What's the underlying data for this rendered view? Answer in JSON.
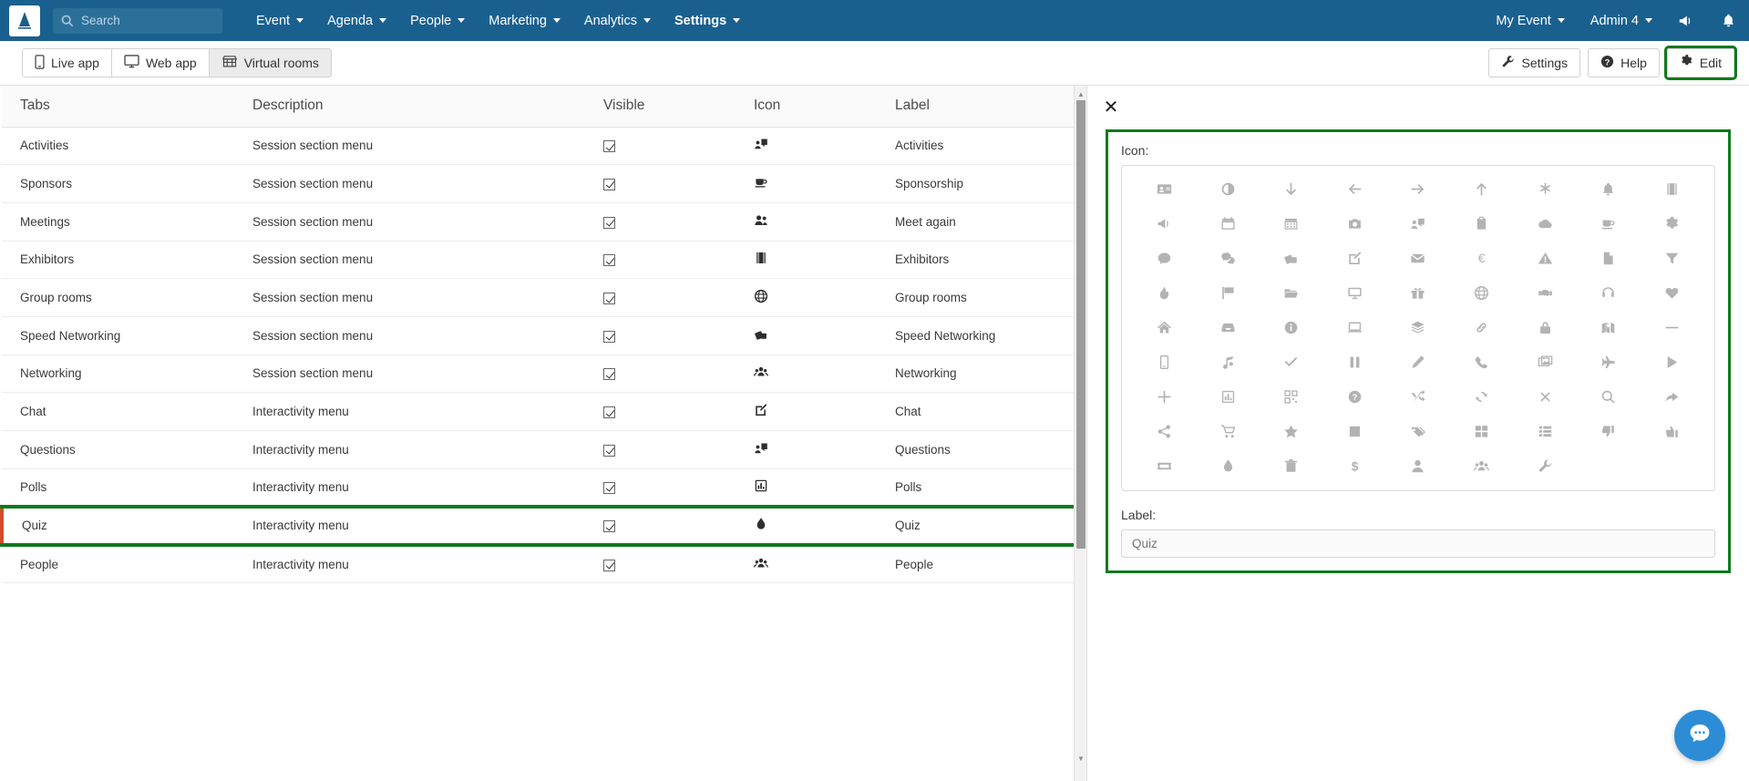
{
  "topnav": {
    "logo_icon": "app-logo-icon",
    "search": {
      "placeholder": "Search",
      "icon": "search-icon"
    },
    "items": [
      {
        "label": "Event",
        "caret": true,
        "bold": false
      },
      {
        "label": "Agenda",
        "caret": true,
        "bold": false
      },
      {
        "label": "People",
        "caret": true,
        "bold": false
      },
      {
        "label": "Marketing",
        "caret": true,
        "bold": false
      },
      {
        "label": "Analytics",
        "caret": true,
        "bold": false
      },
      {
        "label": "Settings",
        "caret": true,
        "bold": true
      }
    ],
    "right_items": [
      {
        "label": "My Event",
        "caret": true
      },
      {
        "label": "Admin 4",
        "caret": true
      }
    ],
    "right_icons": [
      "megaphone-icon",
      "bell-icon"
    ],
    "bg_color": "#19608f"
  },
  "toolbar": {
    "tabs": [
      {
        "label": "Live app",
        "icon": "mobile-icon",
        "active": false
      },
      {
        "label": "Web app",
        "icon": "desktop-icon",
        "active": false
      },
      {
        "label": "Virtual rooms",
        "icon": "store-icon",
        "active": true
      }
    ],
    "actions": [
      {
        "label": "Settings",
        "icon": "wrench-icon",
        "highlighted": false
      },
      {
        "label": "Help",
        "icon": "question-circle-icon",
        "highlighted": false
      },
      {
        "label": "Edit",
        "icon": "gear-icon",
        "highlighted": true
      }
    ],
    "highlight_color": "#0f7a1e"
  },
  "table": {
    "columns": [
      "Tabs",
      "Description",
      "Visible",
      "Icon",
      "Label"
    ],
    "rows": [
      {
        "tab": "Activities",
        "description": "Session section menu",
        "visible": true,
        "icon": "chalkboard-teacher-icon",
        "label": "Activities",
        "highlighted": false
      },
      {
        "tab": "Sponsors",
        "description": "Session section menu",
        "visible": true,
        "icon": "coffee-icon",
        "label": "Sponsorship",
        "highlighted": false
      },
      {
        "tab": "Meetings",
        "description": "Session section menu",
        "visible": true,
        "icon": "user-friends-icon",
        "label": "Meet again",
        "highlighted": false
      },
      {
        "tab": "Exhibitors",
        "description": "Session section menu",
        "visible": true,
        "icon": "book-icon",
        "label": "Exhibitors",
        "highlighted": false
      },
      {
        "tab": "Group rooms",
        "description": "Session section menu",
        "visible": true,
        "icon": "globe-icon",
        "label": "Group rooms",
        "highlighted": false
      },
      {
        "tab": "Speed Networking",
        "description": "Session section menu",
        "visible": true,
        "icon": "dice-icon",
        "label": "Speed Networking",
        "highlighted": false
      },
      {
        "tab": "Networking",
        "description": "Session section menu",
        "visible": true,
        "icon": "users-icon",
        "label": "Networking",
        "highlighted": false
      },
      {
        "tab": "Chat",
        "description": "Interactivity menu",
        "visible": true,
        "icon": "edit-icon",
        "label": "Chat",
        "highlighted": false
      },
      {
        "tab": "Questions",
        "description": "Interactivity menu",
        "visible": true,
        "icon": "chalkboard-teacher-icon",
        "label": "Questions",
        "highlighted": false
      },
      {
        "tab": "Polls",
        "description": "Interactivity menu",
        "visible": true,
        "icon": "chart-bar-icon",
        "label": "Polls",
        "highlighted": false
      },
      {
        "tab": "Quiz",
        "description": "Interactivity menu",
        "visible": true,
        "icon": "tint-icon",
        "label": "Quiz",
        "highlighted": true
      },
      {
        "tab": "People",
        "description": "Interactivity menu",
        "visible": true,
        "icon": "users-icon",
        "label": "People",
        "highlighted": false
      }
    ]
  },
  "side_panel": {
    "close_label": "✕",
    "icon_field_label": "Icon:",
    "label_field_label": "Label:",
    "label_value": "",
    "label_placeholder": "Quiz",
    "highlight_color": "#0f7a1e",
    "icons": [
      "address-card-icon",
      "adjust-icon",
      "arrow-down-icon",
      "arrow-left-icon",
      "arrow-right-icon",
      "arrow-up-icon",
      "asterisk-icon",
      "bell-icon",
      "book-icon",
      "bullhorn-icon",
      "calendar-icon",
      "calendar-alt-icon",
      "camera-icon",
      "chalkboard-teacher-icon",
      "clipboard-icon",
      "cloud-icon",
      "coffee-icon",
      "cog-icon",
      "comment-icon",
      "comments-icon",
      "dice-icon",
      "edit-icon",
      "envelope-icon",
      "euro-sign-icon",
      "exclamation-triangle-icon",
      "file-icon",
      "filter-icon",
      "fire-icon",
      "flag-icon",
      "folder-open-icon",
      "desktop-icon",
      "gift-icon",
      "globe-icon",
      "handshake-icon",
      "headphones-icon",
      "heart-icon",
      "home-icon",
      "inbox-icon",
      "info-circle-icon",
      "laptop-icon",
      "layer-group-icon",
      "link-icon",
      "lock-icon",
      "map-marked-icon",
      "minus-icon",
      "mobile-icon",
      "music-icon",
      "check-icon",
      "pause-icon",
      "pencil-icon",
      "phone-icon",
      "images-icon",
      "plane-icon",
      "play-icon",
      "plus-icon",
      "chart-bar-icon",
      "qrcode-icon",
      "question-circle-icon",
      "random-icon",
      "sync-icon",
      "times-icon",
      "search-icon",
      "share-icon",
      "share-alt-icon",
      "shopping-cart-icon",
      "star-icon",
      "stop-icon",
      "tag-icon",
      "th-large-icon",
      "th-list-icon",
      "thumbs-down-icon",
      "thumbs-up-icon",
      "ticket-icon",
      "tint-icon",
      "trash-icon",
      "dollar-sign-icon",
      "user-icon",
      "users-icon",
      "wrench-icon"
    ]
  },
  "chat_widget": {
    "icon": "chat-bubble-icon",
    "color": "#2c8dd6"
  }
}
